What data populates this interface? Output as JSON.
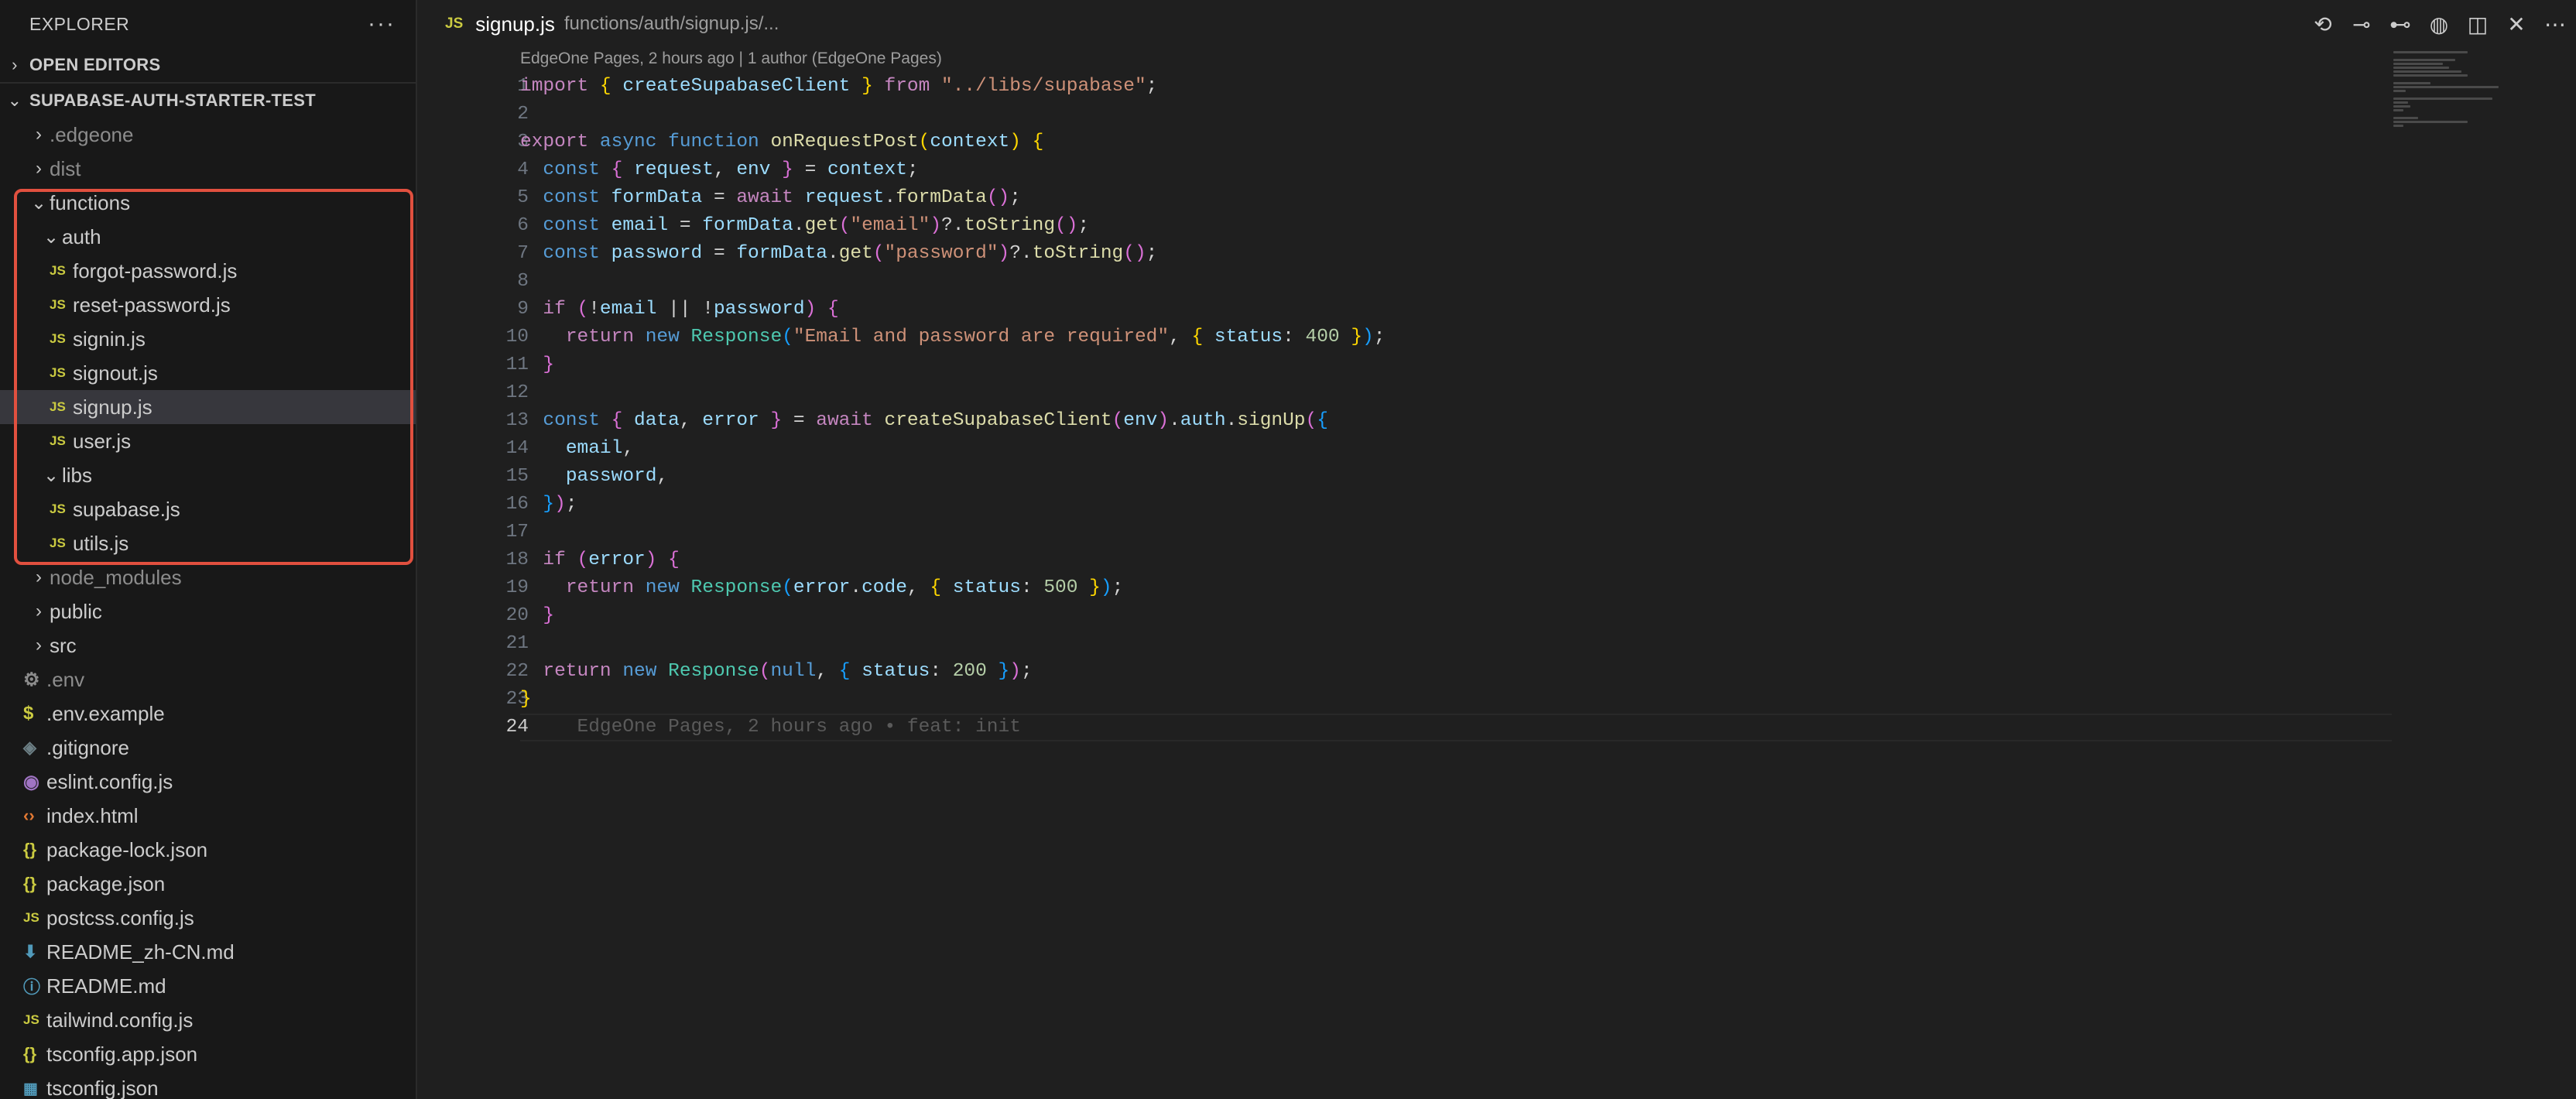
{
  "sidebar": {
    "title": "EXPLORER",
    "more": "···",
    "open_editors": "OPEN EDITORS",
    "project": "SUPABASE-AUTH-STARTER-TEST",
    "items": [
      {
        "label": ".edgeone",
        "kind": "folder",
        "state": "collapsed"
      },
      {
        "label": "dist",
        "kind": "folder",
        "state": "collapsed"
      },
      {
        "label": "functions",
        "kind": "folder",
        "state": "expanded"
      },
      {
        "label": "auth",
        "kind": "folder",
        "state": "expanded"
      },
      {
        "label": "forgot-password.js",
        "kind": "file",
        "icon": "JS"
      },
      {
        "label": "reset-password.js",
        "kind": "file",
        "icon": "JS"
      },
      {
        "label": "signin.js",
        "kind": "file",
        "icon": "JS"
      },
      {
        "label": "signout.js",
        "kind": "file",
        "icon": "JS"
      },
      {
        "label": "signup.js",
        "kind": "file",
        "icon": "JS"
      },
      {
        "label": "user.js",
        "kind": "file",
        "icon": "JS"
      },
      {
        "label": "libs",
        "kind": "folder",
        "state": "expanded"
      },
      {
        "label": "supabase.js",
        "kind": "file",
        "icon": "JS"
      },
      {
        "label": "utils.js",
        "kind": "file",
        "icon": "JS"
      },
      {
        "label": "node_modules",
        "kind": "folder",
        "state": "collapsed"
      },
      {
        "label": "public",
        "kind": "folder",
        "state": "collapsed"
      },
      {
        "label": "src",
        "kind": "folder",
        "state": "collapsed"
      },
      {
        "label": ".env",
        "kind": "file",
        "icon": "gear"
      },
      {
        "label": ".env.example",
        "kind": "file",
        "icon": "$"
      },
      {
        "label": ".gitignore",
        "kind": "file",
        "icon": "git"
      },
      {
        "label": "eslint.config.js",
        "kind": "file",
        "icon": "eslint"
      },
      {
        "label": "index.html",
        "kind": "file",
        "icon": "html"
      },
      {
        "label": "package-lock.json",
        "kind": "file",
        "icon": "{}"
      },
      {
        "label": "package.json",
        "kind": "file",
        "icon": "{}"
      },
      {
        "label": "postcss.config.js",
        "kind": "file",
        "icon": "JS"
      },
      {
        "label": "README_zh-CN.md",
        "kind": "file",
        "icon": "download"
      },
      {
        "label": "README.md",
        "kind": "file",
        "icon": "info"
      },
      {
        "label": "tailwind.config.js",
        "kind": "file",
        "icon": "JS"
      },
      {
        "label": "tsconfig.app.json",
        "kind": "file",
        "icon": "{}"
      },
      {
        "label": "tsconfig.json",
        "kind": "file",
        "icon": "ts"
      }
    ]
  },
  "editor": {
    "tab_icon": "JS",
    "tab_name": "signup.js",
    "tab_path": "functions/auth/signup.js/...",
    "blame_header": "EdgeOne Pages, 2 hours ago | 1 author (EdgeOne Pages)",
    "inline_blame": "EdgeOne Pages, 2 hours ago • feat: init",
    "line_numbers": [
      "1",
      "2",
      "3",
      "4",
      "5",
      "6",
      "7",
      "8",
      "9",
      "10",
      "11",
      "12",
      "13",
      "14",
      "15",
      "16",
      "17",
      "18",
      "19",
      "20",
      "21",
      "22",
      "23",
      "24"
    ],
    "code_lines": [
      "import { createSupabaseClient } from \"../libs/supabase\";",
      "",
      "export async function onRequestPost(context) {",
      "  const { request, env } = context;",
      "  const formData = await request.formData();",
      "  const email = formData.get(\"email\")?.toString();",
      "  const password = formData.get(\"password\")?.toString();",
      "",
      "  if (!email || !password) {",
      "    return new Response(\"Email and password are required\", { status: 400 });",
      "  }",
      "",
      "  const { data, error } = await createSupabaseClient(env).auth.signUp({",
      "    email,",
      "    password,",
      "  });",
      "",
      "  if (error) {",
      "    return new Response(error.code, { status: 500 });",
      "  }",
      "",
      "  return new Response(null, { status: 200 });",
      "}",
      ""
    ]
  },
  "colors": {
    "highlight_box": "#e1503f",
    "selected_row": "#37373d",
    "js_icon": "#cbcb41"
  }
}
